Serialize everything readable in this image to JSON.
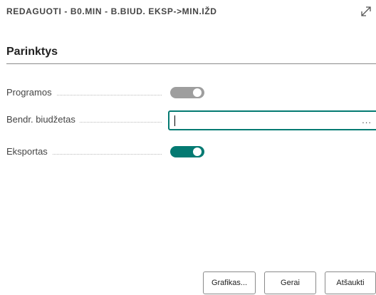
{
  "dialog": {
    "title": "REDAGUOTI - B0.MIN - B.BIUD. EKSP->MIN.IŽD"
  },
  "section": {
    "title": "Parinktys"
  },
  "fields": {
    "programos": {
      "label": "Programos",
      "toggle_state": "on",
      "toggle_color": "#9e9e9e"
    },
    "bendr_biudzetas": {
      "label": "Bendr. biudžetas",
      "value": "",
      "lookup_glyph": "..."
    },
    "eksportas": {
      "label": "Eksportas",
      "toggle_state": "on",
      "toggle_color": "#047a72"
    }
  },
  "buttons": {
    "grafikas": "Grafikas...",
    "gerai": "Gerai",
    "atsaukti": "Atšaukti"
  },
  "colors": {
    "accent": "#047a72",
    "toggle_disabled": "#9e9e9e",
    "rule": "#8a8a8a"
  }
}
